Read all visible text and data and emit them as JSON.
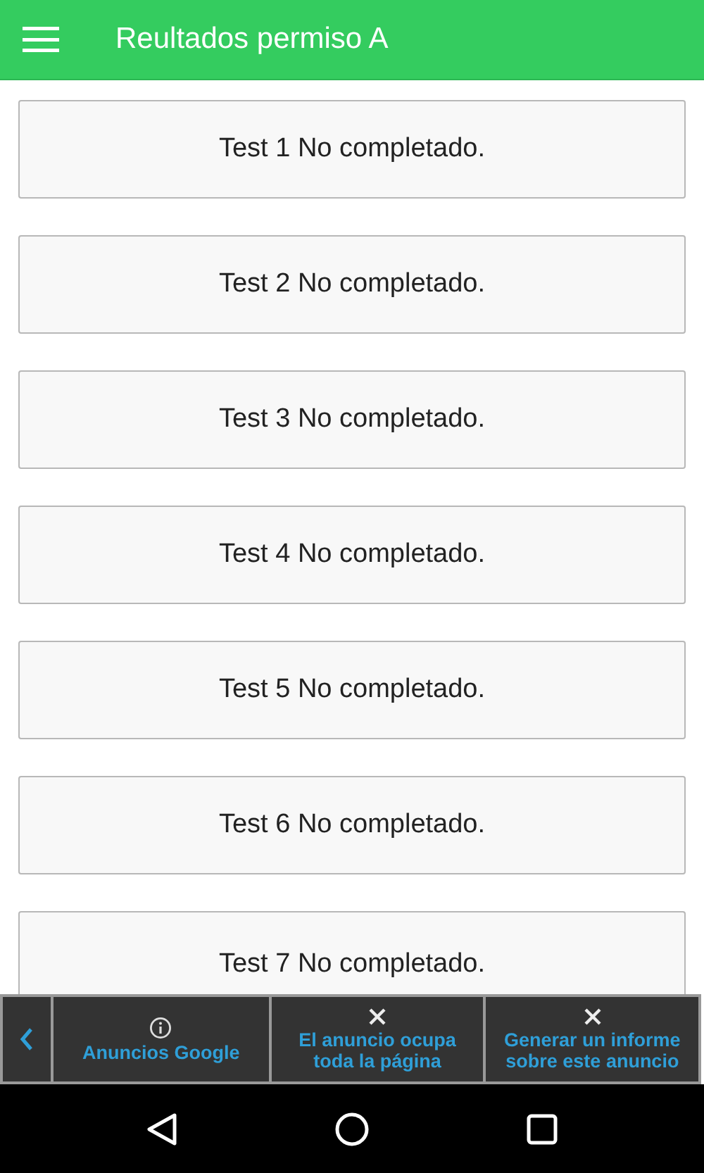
{
  "app_bar": {
    "title": "Reultados permiso A"
  },
  "tests": [
    "Test 1 No completado.",
    "Test 2 No completado.",
    "Test 3 No completado.",
    "Test 4 No completado.",
    "Test 5 No completado.",
    "Test 6 No completado.",
    "Test 7 No completado."
  ],
  "ad_bar": {
    "items": [
      {
        "kind": "info",
        "label": "Anuncios Google"
      },
      {
        "kind": "close",
        "label": "El anuncio ocupa toda la página"
      },
      {
        "kind": "close",
        "label": "Generar un informe sobre este anuncio"
      }
    ]
  }
}
